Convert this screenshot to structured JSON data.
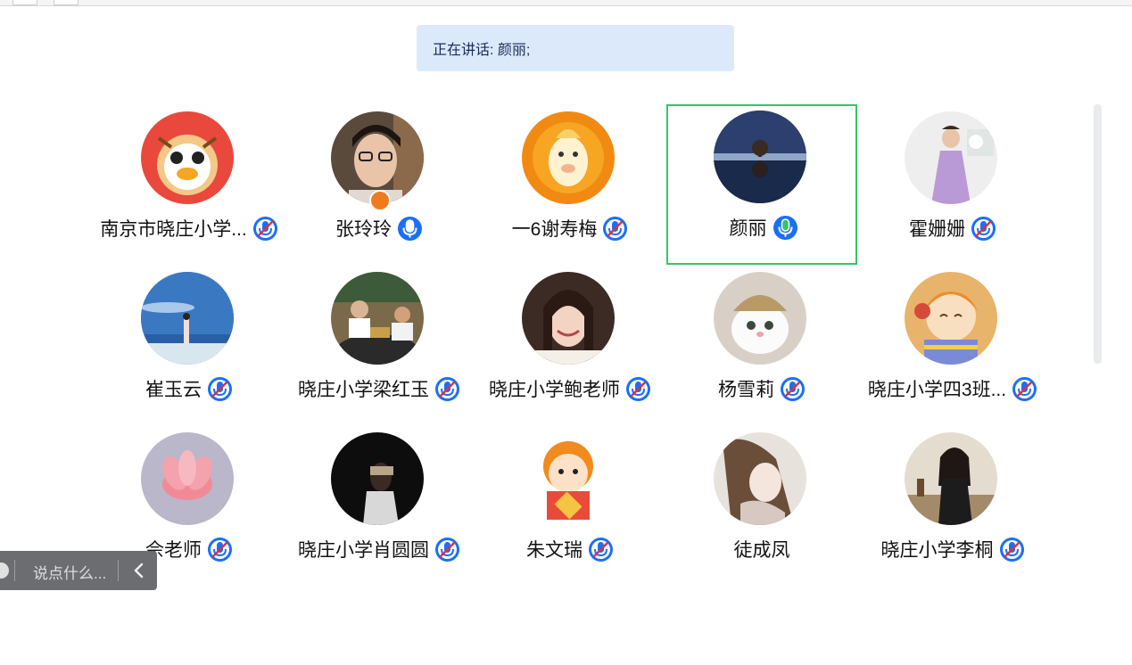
{
  "speaking": {
    "text": "正在讲话: 颜丽;"
  },
  "participants": [
    {
      "name": "南京市晓庄小学...",
      "mic": "muted",
      "active": false,
      "avatar": "cartoon-tiger"
    },
    {
      "name": "张玲玲",
      "mic": "on",
      "active": false,
      "avatar": "glasses-woman",
      "host": true
    },
    {
      "name": "一6谢寿梅",
      "mic": "muted",
      "active": false,
      "avatar": "cartoon-horse"
    },
    {
      "name": "颜丽",
      "mic": "speaking",
      "active": true,
      "avatar": "tree-lake"
    },
    {
      "name": "霍姗姗",
      "mic": "muted",
      "active": false,
      "avatar": "girl-purple-dress"
    },
    {
      "name": "崔玉云",
      "mic": "muted",
      "active": false,
      "avatar": "beach-sky"
    },
    {
      "name": "晓庄小学梁红玉",
      "mic": "muted",
      "active": false,
      "avatar": "family-dinner"
    },
    {
      "name": "晓庄小学鲍老师",
      "mic": "muted",
      "active": false,
      "avatar": "smiling-woman"
    },
    {
      "name": "杨雪莉",
      "mic": "muted",
      "active": false,
      "avatar": "kitten-hat"
    },
    {
      "name": "晓庄小学四3班...",
      "mic": "muted",
      "active": false,
      "avatar": "cartoon-kid"
    },
    {
      "name": "佘老师",
      "mic": "muted",
      "active": false,
      "avatar": "lotus-flower"
    },
    {
      "name": "晓庄小学肖圆圆",
      "mic": "muted",
      "active": false,
      "avatar": "dark-portrait"
    },
    {
      "name": "朱文瑞",
      "mic": "muted",
      "active": false,
      "avatar": "tiger-girl-fu"
    },
    {
      "name": "徒成凤",
      "mic": "none",
      "active": false,
      "avatar": "drawn-woman"
    },
    {
      "name": "晓庄小学李桐",
      "mic": "muted",
      "active": false,
      "avatar": "fashion-woman"
    }
  ],
  "chat": {
    "placeholder": "说点什么..."
  },
  "colors": {
    "accent": "#1a6ff5",
    "active_border": "#34c46b",
    "banner_bg": "#dbe9fb",
    "mic_muted": "#1a6ff5",
    "mic_speaking": "#34c46b"
  }
}
